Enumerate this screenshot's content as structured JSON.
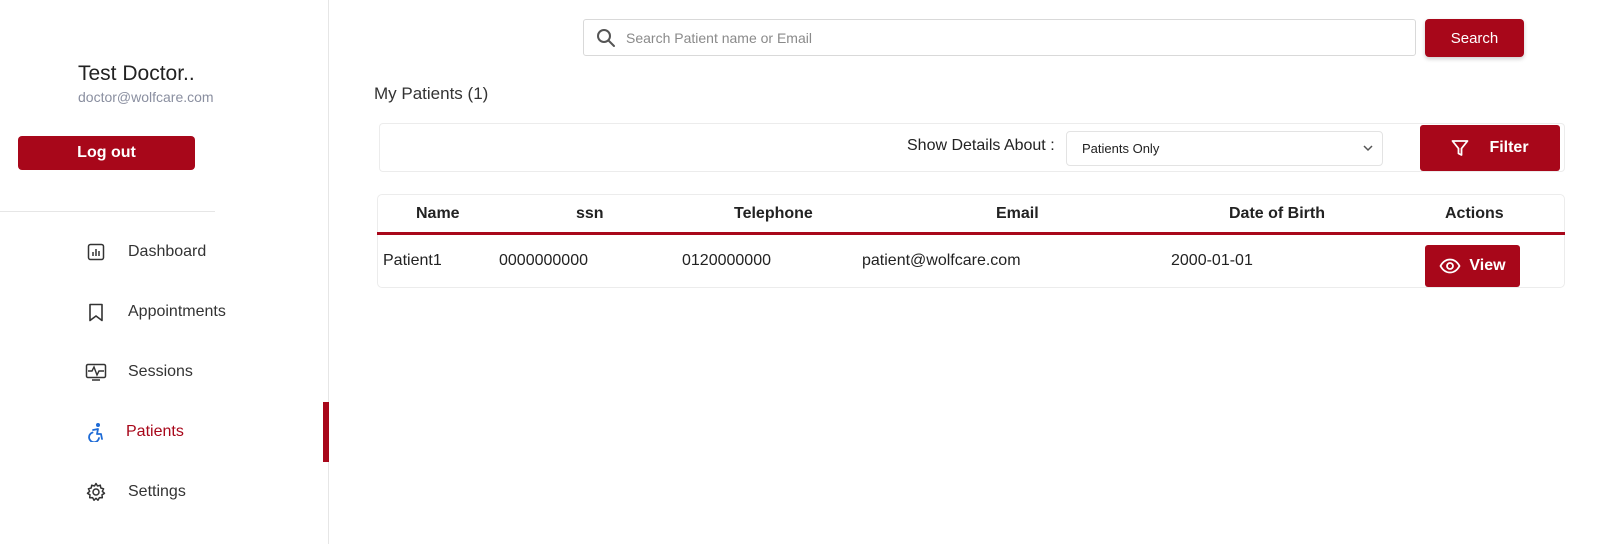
{
  "sidebar": {
    "user_name": "Test Doctor..",
    "user_email": "doctor@wolfcare.com",
    "logout_label": "Log out",
    "items": [
      {
        "label": "Dashboard",
        "icon": "chart-icon"
      },
      {
        "label": "Appointments",
        "icon": "bookmark-icon"
      },
      {
        "label": "Sessions",
        "icon": "monitor-pulse-icon"
      },
      {
        "label": "Patients",
        "icon": "accessibility-icon",
        "active": true
      },
      {
        "label": "Settings",
        "icon": "gear-icon"
      }
    ]
  },
  "search": {
    "placeholder": "Search Patient name or Email",
    "value": "",
    "button_label": "Search"
  },
  "main": {
    "title": "My Patients (1)",
    "filter": {
      "label": "Show Details About :",
      "selected": "Patients Only",
      "button_label": "Filter"
    }
  },
  "table": {
    "columns": [
      "Name",
      "ssn",
      "Telephone",
      "Email",
      "Date of Birth",
      "Actions"
    ],
    "rows": [
      {
        "name": "Patient1",
        "ssn": "0000000000",
        "telephone": "0120000000",
        "email": "patient@wolfcare.com",
        "dob": "2000-01-01",
        "action_label": "View"
      }
    ]
  },
  "colors": {
    "accent": "#a8071a",
    "active_icon": "#1e6bd6"
  }
}
